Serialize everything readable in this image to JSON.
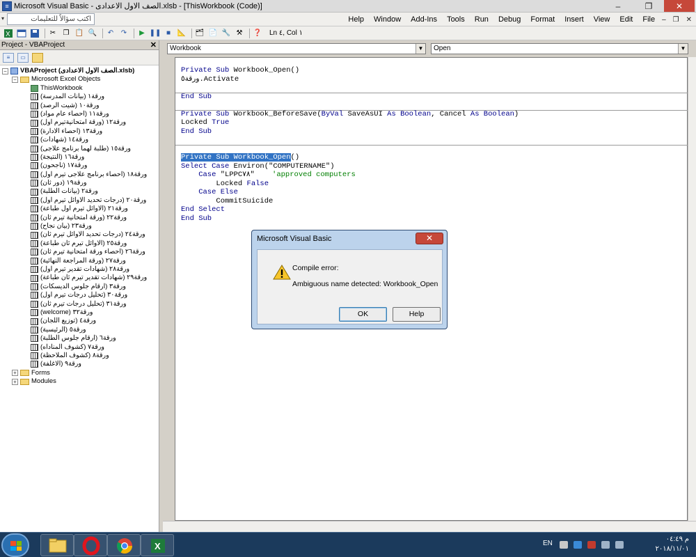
{
  "titlebar": {
    "title": "Microsoft Visual Basic - الصف الاول الاعدادى.xlsb - [ThisWorkbook (Code)]",
    "minimize": "–",
    "restore": "❐",
    "close": "✕"
  },
  "menubar": {
    "help_placeholder": "اكتب سؤالاً للتعليمات",
    "items": [
      "Help",
      "Window",
      "Add-Ins",
      "Tools",
      "Run",
      "Debug",
      "Format",
      "Insert",
      "View",
      "Edit",
      "File"
    ],
    "controls": [
      "–",
      "❐",
      "✕"
    ]
  },
  "toolbar": {
    "position": "Ln ٤, Col ١"
  },
  "project": {
    "title": "Project - VBAProject",
    "close": "✕",
    "root": "VBAProject (الصف الاول الاعدادى.xlsb)",
    "objects_folder": "Microsoft Excel Objects",
    "workbook": "ThisWorkbook",
    "sheets": [
      "ورقة١ (بيانات المدرسة)",
      "ورقة١٠ (شيت الرصد)",
      "ورقة١١ (احصاء عام مواد)",
      "ورقة١٢ (ورقة امتحانيةتيرم اول)",
      "ورقة١٣ (احصاء الادارة)",
      "ورقة١٤ (شهادات)",
      "ورقة١٥ (طلبة لهما برنامج علاجى)",
      "ورقة١٦ (النتيجة)",
      "ورقة١٧ (ناجحون)",
      "ورقة١٨ (احصاء برنامج علاجى تيرم اول)",
      "ورقة١٩ (دور ثان)",
      "ورقة٢ (بيانات الطلبة)",
      "ورقة٢٠ (درجات تحديد الاوائل تيرم اول)",
      "ورقة٢١ (الاوائل تيرم اول طباعة)",
      "ورقة٢٢ (ورقة امتحانية تيرم ثان)",
      "ورقة٢٣ (بيان نجاح)",
      "ورقة٢٤ (درجات تحديد الاوائل تيرم ثان)",
      "ورقة٢٥ (الاوائل تيرم ثان طباعة)",
      "ورقة٢٦ (احصاء ورقة امتحانية تيرم ثان)",
      "ورقة٢٧ (ورقة المراجعة النهائية)",
      "ورقة٢٨ (شهادات تقدير تيرم اول)",
      "ورقة٢٩ (شهادات تقدير تيرم ثان طباعة)",
      "ورقة٣ (ارقام جلوس الديسكات)",
      "ورقة٣٠ (تحليل درجات تيرم اول)",
      "ورقة٣١ (تحليل درجات تيرم ثان)",
      "ورقة٣٢ (welcome)",
      "ورقة٤ (توزيع اللجان)",
      "ورقة٥ (الرئيسية)",
      "ورقة٦ (ارقام جلوس الطلبة)",
      "ورقة٧ (كشوف المناداه)",
      "ورقة٨ (كشوف الملاحظة)",
      "ورقة٩ (الاغلفة)"
    ],
    "forms_folder": "Forms",
    "modules_folder": "Modules"
  },
  "code": {
    "object_combo": "Workbook",
    "proc_combo": "Open",
    "lines": {
      "l1a": "Private Sub",
      "l1b": " Workbook_Open()",
      "l2": "ورقة٥.Activate",
      "l3": "End Sub",
      "l4a": "Private Sub",
      "l4b": " Workbook_BeforeSave(",
      "l4c": "ByVal",
      "l4d": " SaveAsUI ",
      "l4e": "As Boolean",
      "l4f": ", Cancel ",
      "l4g": "As Boolean",
      "l4h": ")",
      "l5a": "Locked ",
      "l5b": "True",
      "l6": "End Sub",
      "l7sel": "Private Sub Workbook_Open",
      "l7b": "()",
      "l8a": "Select Case",
      "l8b": " Environ(\"COMPUTERNAME\")",
      "l9a": "    Case",
      "l9b": " \"LPPC٧٨\"    ",
      "l9c": "'approved computers",
      "l10a": "        Locked ",
      "l10b": "False",
      "l11": "    Case Else",
      "l12": "        CommitSuicide",
      "l13": "End Select",
      "l14": "End Sub"
    }
  },
  "dialog": {
    "title": "Microsoft Visual Basic",
    "close": "✕",
    "line1": "Compile error:",
    "line2": "Ambiguous name detected: Workbook_Open",
    "ok": "OK",
    "help": "Help"
  },
  "taskbar": {
    "lang": "EN",
    "time": "م ٠٤:٤٩",
    "date": "٢٠١٨/١١/٠١"
  },
  "colors": {
    "keyword": "#00008b",
    "comment": "#007f00",
    "selection": "#3173c4",
    "close": "#c6483a"
  }
}
